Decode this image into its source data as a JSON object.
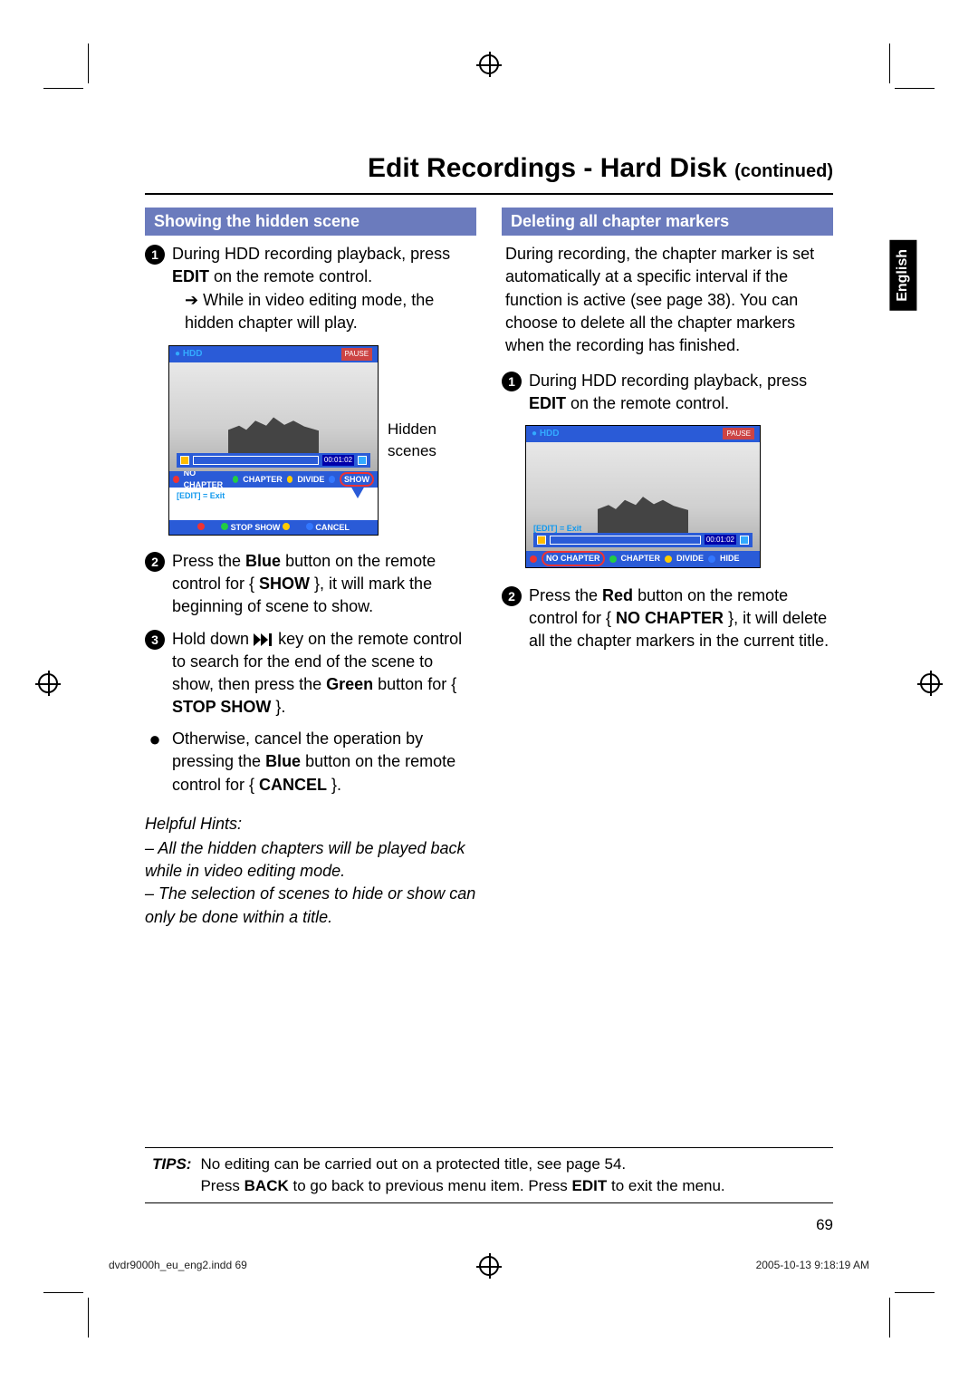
{
  "page": {
    "title_main": "Edit Recordings - Hard Disk",
    "title_cont": "(continued)",
    "number": "69",
    "language_tab": "English"
  },
  "left": {
    "heading": "Showing the hidden scene",
    "step1_a": "During HDD recording playback, press ",
    "step1_b": "EDIT",
    "step1_c": " on the remote control.",
    "step1_sub": "While in video editing mode, the hidden chapter will play.",
    "thumb_label": "Hidden scenes",
    "osd": {
      "hdd": "HDD",
      "pause": "PAUSE",
      "time": "00:01:02",
      "exit": "[EDIT] = Exit",
      "opt1": "NO CHAPTER",
      "opt2": "CHAPTER",
      "opt3": "DIVIDE",
      "opt4": "SHOW",
      "extra1": "STOP SHOW",
      "extra2": "CANCEL"
    },
    "step2_a": "Press the ",
    "step2_b": "Blue",
    "step2_c": " button on the remote control for { ",
    "step2_d": "SHOW",
    "step2_e": " }, it will mark the beginning of scene to show.",
    "step3_a": "Hold down ",
    "step3_b": " key on the remote control to search for the end of the scene to show, then press the ",
    "step3_c": "Green",
    "step3_d": " button for { ",
    "step3_e": "STOP SHOW",
    "step3_f": " }.",
    "bullet_a": "Otherwise, cancel the operation by pressing the ",
    "bullet_b": "Blue",
    "bullet_c": " button on the remote control for { ",
    "bullet_d": "CANCEL",
    "bullet_e": " }.",
    "hints_title": "Helpful Hints:",
    "hints1": "– All the hidden chapters will be played back while in video editing mode.",
    "hints2": "– The selection of scenes to hide or show can only be done within a title."
  },
  "right": {
    "heading": "Deleting all chapter markers",
    "intro": "During recording, the chapter marker is set automatically at a specific interval if the function is active (see page 38). You can choose to delete all the chapter markers when the recording has finished.",
    "step1_a": "During HDD recording playback, press ",
    "step1_b": "EDIT",
    "step1_c": " on the remote control.",
    "osd": {
      "hdd": "HDD",
      "pause": "PAUSE",
      "time": "00:01:02",
      "exit": "[EDIT] = Exit",
      "opt1": "NO CHAPTER",
      "opt2": "CHAPTER",
      "opt3": "DIVIDE",
      "opt4": "HIDE"
    },
    "step2_a": "Press the ",
    "step2_b": "Red",
    "step2_c": " button on the remote control for { ",
    "step2_d": "NO CHAPTER",
    "step2_e": " }, it will delete all the chapter markers in the current title."
  },
  "tips": {
    "label": "TIPS:",
    "line1": "No editing can be carried out on a protected title, see page 54.",
    "line2a": "Press ",
    "line2b": "BACK",
    "line2c": " to go back to previous menu item. Press ",
    "line2d": "EDIT",
    "line2e": " to exit the menu."
  },
  "footer": {
    "left": "dvdr9000h_eu_eng2.indd   69",
    "right": "2005-10-13   9:18:19 AM"
  }
}
